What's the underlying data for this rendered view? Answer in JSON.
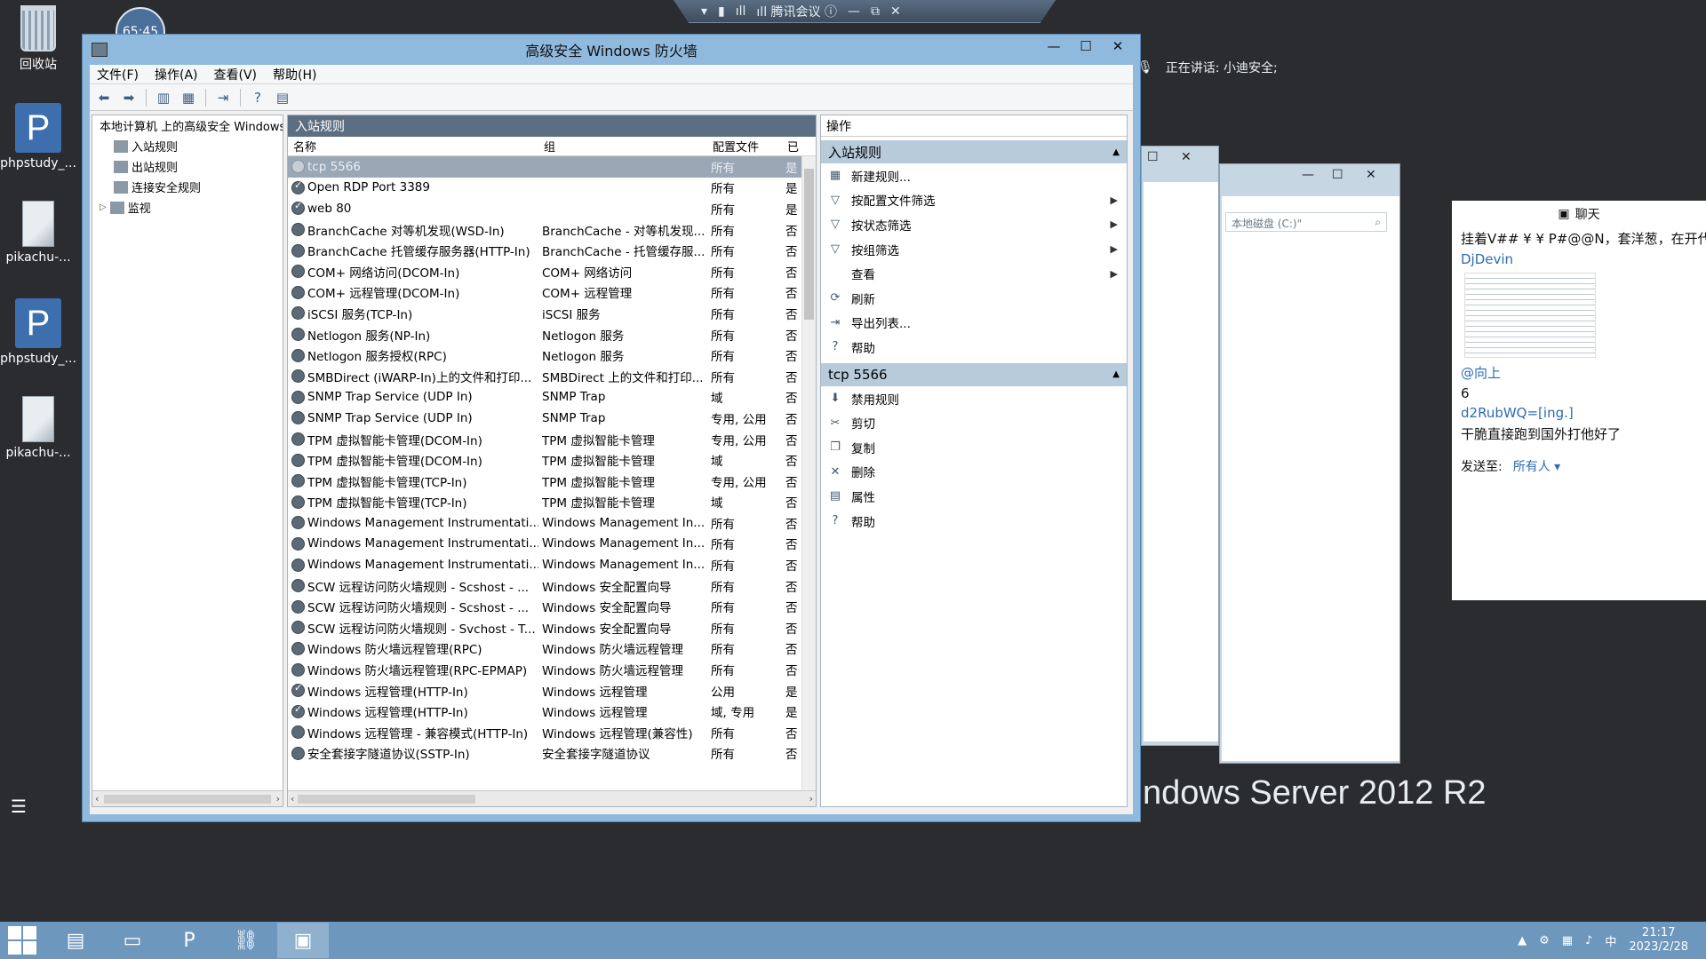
{
  "remote_bar": {
    "items": [
      "▾",
      "▮",
      "ıll",
      "ıll 腾讯会议 ⓘ",
      "—",
      "⧉",
      "✕"
    ]
  },
  "clock_badge": "65:45",
  "desktop_icons": [
    {
      "label": "回收站"
    },
    {
      "label": "phpstudy_..."
    },
    {
      "label": "pikachu-..."
    },
    {
      "label": "phpstudy_..."
    },
    {
      "label": "pikachu-..."
    }
  ],
  "window": {
    "title": "高级安全 Windows 防火墙",
    "controls": [
      "—",
      "☐",
      "✕"
    ],
    "menu": [
      "文件(F)",
      "操作(A)",
      "查看(V)",
      "帮助(H)"
    ],
    "toolbar_icons": [
      "back-icon",
      "forward-icon",
      "up-icon",
      "show-hide-tree-icon",
      "export-icon",
      "help-icon",
      "properties-icon"
    ]
  },
  "tree": {
    "root": "本地计算机 上的高级安全 Windows",
    "items": [
      "入站规则",
      "出站规则",
      "连接安全规则",
      "监视"
    ]
  },
  "rules_pane": {
    "header": "入站规则",
    "columns": [
      "名称",
      "组",
      "配置文件",
      "已"
    ],
    "rows": [
      {
        "name": "tcp 5566",
        "group": "",
        "profile": "所有",
        "enabled": "是",
        "state": "off"
      },
      {
        "name": "Open RDP Port 3389",
        "group": "",
        "profile": "所有",
        "enabled": "是",
        "state": "on"
      },
      {
        "name": "web 80",
        "group": "",
        "profile": "所有",
        "enabled": "是",
        "state": "on"
      },
      {
        "name": "BranchCache 对等机发现(WSD-In)",
        "group": "BranchCache - 对等机发现...",
        "profile": "所有",
        "enabled": "否",
        "state": "none"
      },
      {
        "name": "BranchCache 托管缓存服务器(HTTP-In)",
        "group": "BranchCache - 托管缓存服...",
        "profile": "所有",
        "enabled": "否",
        "state": "none"
      },
      {
        "name": "COM+ 网络访问(DCOM-In)",
        "group": "COM+ 网络访问",
        "profile": "所有",
        "enabled": "否",
        "state": "none"
      },
      {
        "name": "COM+ 远程管理(DCOM-In)",
        "group": "COM+ 远程管理",
        "profile": "所有",
        "enabled": "否",
        "state": "none"
      },
      {
        "name": "iSCSI 服务(TCP-In)",
        "group": "iSCSI 服务",
        "profile": "所有",
        "enabled": "否",
        "state": "none"
      },
      {
        "name": "Netlogon 服务(NP-In)",
        "group": "Netlogon 服务",
        "profile": "所有",
        "enabled": "否",
        "state": "none"
      },
      {
        "name": "Netlogon 服务授权(RPC)",
        "group": "Netlogon 服务",
        "profile": "所有",
        "enabled": "否",
        "state": "none"
      },
      {
        "name": "SMBDirect (iWARP-In)上的文件和打印...",
        "group": "SMBDirect 上的文件和打印...",
        "profile": "所有",
        "enabled": "否",
        "state": "none"
      },
      {
        "name": "SNMP Trap Service (UDP In)",
        "group": "SNMP Trap",
        "profile": "域",
        "enabled": "否",
        "state": "none"
      },
      {
        "name": "SNMP Trap Service (UDP In)",
        "group": "SNMP Trap",
        "profile": "专用, 公用",
        "enabled": "否",
        "state": "none"
      },
      {
        "name": "TPM 虚拟智能卡管理(DCOM-In)",
        "group": "TPM 虚拟智能卡管理",
        "profile": "专用, 公用",
        "enabled": "否",
        "state": "none"
      },
      {
        "name": "TPM 虚拟智能卡管理(DCOM-In)",
        "group": "TPM 虚拟智能卡管理",
        "profile": "域",
        "enabled": "否",
        "state": "none"
      },
      {
        "name": "TPM 虚拟智能卡管理(TCP-In)",
        "group": "TPM 虚拟智能卡管理",
        "profile": "专用, 公用",
        "enabled": "否",
        "state": "none"
      },
      {
        "name": "TPM 虚拟智能卡管理(TCP-In)",
        "group": "TPM 虚拟智能卡管理",
        "profile": "域",
        "enabled": "否",
        "state": "none"
      },
      {
        "name": "Windows Management Instrumentati...",
        "group": "Windows Management In...",
        "profile": "所有",
        "enabled": "否",
        "state": "none"
      },
      {
        "name": "Windows Management Instrumentati...",
        "group": "Windows Management In...",
        "profile": "所有",
        "enabled": "否",
        "state": "none"
      },
      {
        "name": "Windows Management Instrumentati...",
        "group": "Windows Management In...",
        "profile": "所有",
        "enabled": "否",
        "state": "none"
      },
      {
        "name": "SCW 远程访问防火墙规则 - Scshost - ...",
        "group": "Windows 安全配置向导",
        "profile": "所有",
        "enabled": "否",
        "state": "none"
      },
      {
        "name": "SCW 远程访问防火墙规则 - Scshost - ...",
        "group": "Windows 安全配置向导",
        "profile": "所有",
        "enabled": "否",
        "state": "none"
      },
      {
        "name": "SCW 远程访问防火墙规则 - Svchost - T...",
        "group": "Windows 安全配置向导",
        "profile": "所有",
        "enabled": "否",
        "state": "none"
      },
      {
        "name": "Windows 防火墙远程管理(RPC)",
        "group": "Windows 防火墙远程管理",
        "profile": "所有",
        "enabled": "否",
        "state": "none"
      },
      {
        "name": "Windows 防火墙远程管理(RPC-EPMAP)",
        "group": "Windows 防火墙远程管理",
        "profile": "所有",
        "enabled": "否",
        "state": "none"
      },
      {
        "name": "Windows 远程管理(HTTP-In)",
        "group": "Windows 远程管理",
        "profile": "公用",
        "enabled": "是",
        "state": "on"
      },
      {
        "name": "Windows 远程管理(HTTP-In)",
        "group": "Windows 远程管理",
        "profile": "域, 专用",
        "enabled": "是",
        "state": "on"
      },
      {
        "name": "Windows 远程管理 - 兼容模式(HTTP-In)",
        "group": "Windows 远程管理(兼容性)",
        "profile": "所有",
        "enabled": "否",
        "state": "none"
      },
      {
        "name": "安全套接字隧道协议(SSTP-In)",
        "group": "安全套接字隧道协议",
        "profile": "所有",
        "enabled": "否",
        "state": "none"
      }
    ]
  },
  "actions_pane": {
    "header": "操作",
    "section1": {
      "title": "入站规则",
      "items": [
        {
          "label": "新建规则...",
          "icon": "new-rule-icon",
          "glyph": "▦",
          "submenu": false
        },
        {
          "label": "按配置文件筛选",
          "icon": "filter-icon",
          "glyph": "▽",
          "submenu": true
        },
        {
          "label": "按状态筛选",
          "icon": "filter-icon",
          "glyph": "▽",
          "submenu": true
        },
        {
          "label": "按组筛选",
          "icon": "filter-icon",
          "glyph": "▽",
          "submenu": true
        },
        {
          "label": "查看",
          "icon": "view-icon",
          "glyph": "",
          "submenu": true
        },
        {
          "label": "刷新",
          "icon": "refresh-icon",
          "glyph": "⟳",
          "submenu": false
        },
        {
          "label": "导出列表...",
          "icon": "export-icon",
          "glyph": "⇥",
          "submenu": false
        },
        {
          "label": "帮助",
          "icon": "help-icon",
          "glyph": "?",
          "submenu": false
        }
      ]
    },
    "section2": {
      "title": "tcp 5566",
      "items": [
        {
          "label": "禁用规则",
          "icon": "disable-rule-icon",
          "glyph": "⬇"
        },
        {
          "label": "剪切",
          "icon": "cut-icon",
          "glyph": "✂"
        },
        {
          "label": "复制",
          "icon": "copy-icon",
          "glyph": "❐"
        },
        {
          "label": "删除",
          "icon": "delete-icon",
          "glyph": "✕"
        },
        {
          "label": "属性",
          "icon": "properties-icon",
          "glyph": "▤"
        },
        {
          "label": "帮助",
          "icon": "help-icon",
          "glyph": "?"
        }
      ]
    }
  },
  "speaking_label": "正在讲话: 小迪安全;",
  "explorer_search_placeholder": "本地磁盘 (C:)\"",
  "server_brand": "ndows Server 2012 R2",
  "chat": {
    "title": "聊天",
    "messages": [
      {
        "type": "text",
        "text": "挂着V## ¥ ¥ P#@@N，套洋葱，在开代"
      },
      {
        "type": "user",
        "text": "DjDevin"
      },
      {
        "type": "image"
      },
      {
        "type": "user",
        "text": "@向上"
      },
      {
        "type": "text",
        "text": "6"
      },
      {
        "type": "user",
        "text": "d2RubWQ=[ing.]"
      },
      {
        "type": "text",
        "text": "干脆直接跑到国外打他好了"
      }
    ],
    "send_label": "发送至:",
    "send_target": "所有人 ▾"
  },
  "taskbar": {
    "clock_time": "21:17",
    "clock_date": "2023/2/28",
    "ime": "中"
  }
}
